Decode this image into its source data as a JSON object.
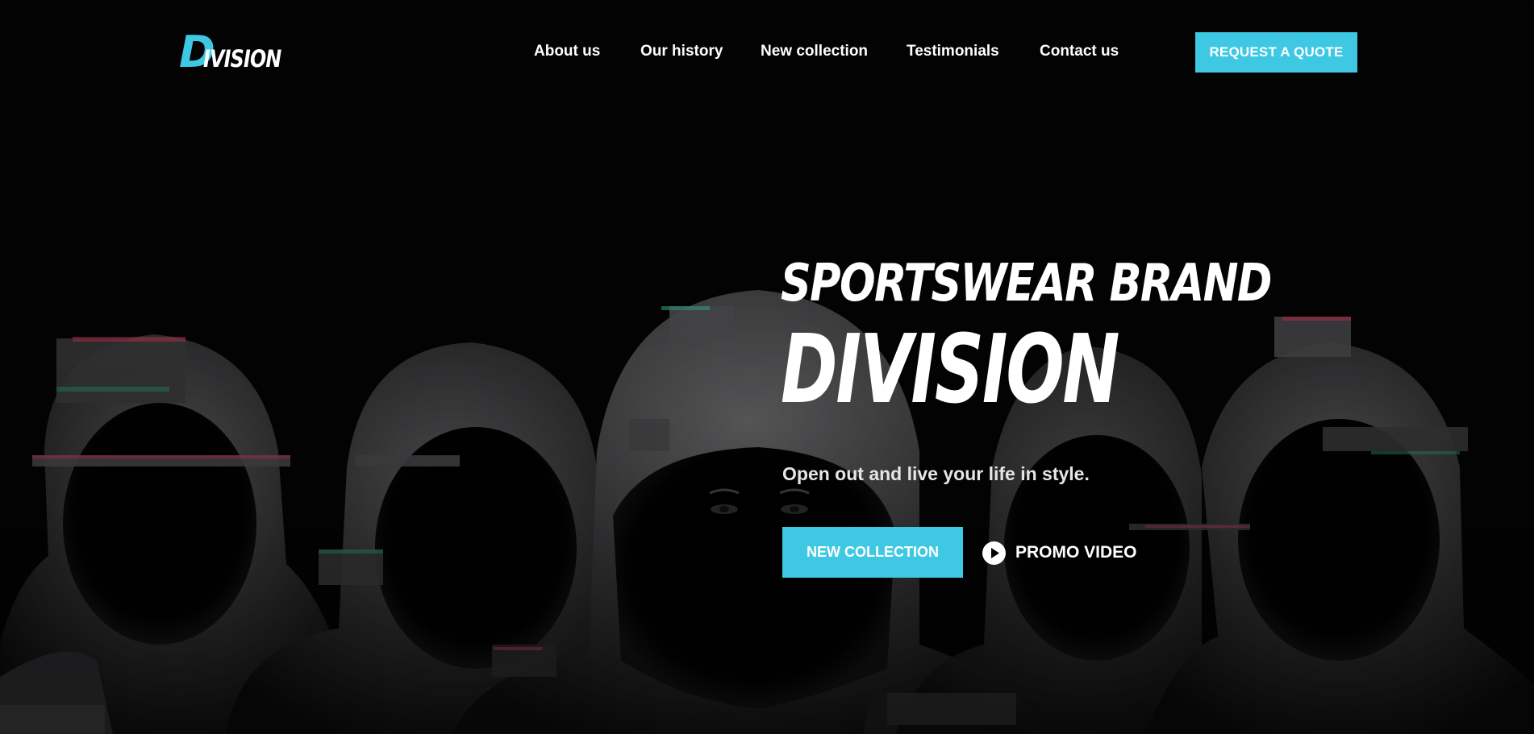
{
  "brand": {
    "logo_initial": "D",
    "logo_rest": "IVISION"
  },
  "nav": {
    "items": [
      {
        "label": "About us"
      },
      {
        "label": "Our history"
      },
      {
        "label": "New collection"
      },
      {
        "label": "Testimonials"
      },
      {
        "label": "Contact us"
      }
    ],
    "cta_label": "REQUEST A QUOTE"
  },
  "hero": {
    "subtitle": "SPORTSWEAR BRAND",
    "title": "DIVISION",
    "tagline": "Open out and live your life in style.",
    "primary_button": "NEW COLLECTION",
    "secondary_button": "PROMO VIDEO",
    "secondary_icon": "play-circle-icon"
  },
  "colors": {
    "accent": "#3ec8e4",
    "background": "#040405",
    "text": "#ffffff"
  }
}
